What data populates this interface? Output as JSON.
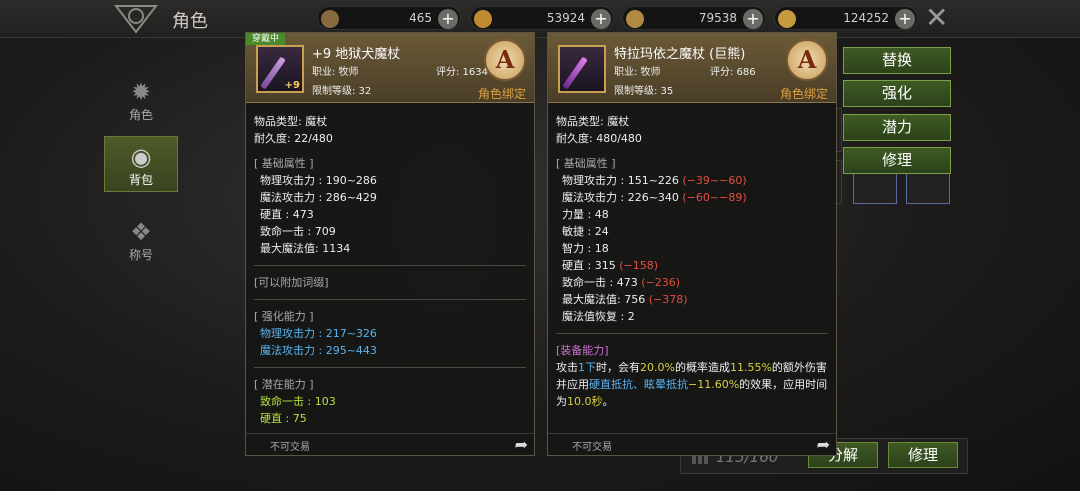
{
  "header": {
    "title": "角色",
    "resources": [
      {
        "icon": "ticket-icon",
        "value": "465",
        "color": "#8a6a40"
      },
      {
        "icon": "coin-ring-icon",
        "value": "53924",
        "color": "#c08a30"
      },
      {
        "icon": "gold-bag-icon",
        "value": "79538",
        "color": "#b08a40"
      },
      {
        "icon": "gem-coin-icon",
        "value": "124252",
        "color": "#c89a40"
      }
    ]
  },
  "nav": {
    "items": [
      {
        "label": "角色",
        "icon": "character-icon"
      },
      {
        "label": "背包",
        "icon": "backpack-icon"
      },
      {
        "label": "称号",
        "icon": "title-icon"
      }
    ],
    "active": "背包"
  },
  "actions": [
    "替换",
    "强化",
    "潜力",
    "修理"
  ],
  "bottom": {
    "capacity": "115/160",
    "decompose": "分解",
    "repair": "修理"
  },
  "equipped": {
    "tag": "穿戴中",
    "name": "+9 地狱犬魔杖",
    "enhance": "+9",
    "job": "职业: 牧师",
    "score": "评分: 1634",
    "level_req": "限制等级: 32",
    "grade": "A",
    "bind": "角色绑定",
    "type": "物品类型:   魔杖",
    "durability": "耐久度: 22/480",
    "base_header": "[ 基础属性 ]",
    "base": [
      "物理攻击力 : 190~286",
      "魔法攻击力 : 286~429",
      "硬直 : 473",
      "致命一击 : 709",
      "最大魔法值:   1134"
    ],
    "enchant_note": "[可以附加词缀]",
    "enhance_header": "[ 强化能力 ]",
    "enhance_stats": [
      "物理攻击力 : 217~326",
      "魔法攻击力 : 295~443"
    ],
    "potential_header": "[ 潜在能力 ]",
    "potential": [
      "致命一击 : 103",
      "硬直 : 75"
    ],
    "trade": "不可交易"
  },
  "compare": {
    "name": "特拉玛依之魔杖 (巨熊)",
    "job": "职业: 牧师",
    "score": "评分: 686",
    "level_req": "限制等级: 35",
    "grade": "A",
    "bind": "角色绑定",
    "type": "物品类型:   魔杖",
    "durability": "耐久度: 480/480",
    "base_header": "[ 基础属性 ]",
    "base": [
      {
        "text": "物理攻击力 : 151~226 ",
        "diff": "(−39~−60)"
      },
      {
        "text": "魔法攻击力 : 226~340 ",
        "diff": "(−60~−89)"
      },
      {
        "text": "力量 : 48",
        "diff": ""
      },
      {
        "text": "敏捷 : 24",
        "diff": ""
      },
      {
        "text": "智力 : 18",
        "diff": ""
      },
      {
        "text": "硬直 : 315 ",
        "diff": "(−158)"
      },
      {
        "text": "致命一击 : 473 ",
        "diff": "(−236)"
      },
      {
        "text": "最大魔法值:   756 ",
        "diff": "(−378)"
      },
      {
        "text": "魔法值恢复 : 2",
        "diff": ""
      }
    ],
    "equip_header": "[装备能力]",
    "effect": {
      "p1": "攻击",
      "h1": "1下",
      "p2": "时，会有",
      "h2": "20.0%",
      "p3": "的概率造成",
      "h3": "11.55%",
      "p4": "的额外伤害并应用",
      "h4": "硬直抵抗、眩晕抵抗",
      "h5": "−11.60%",
      "p5": "的效果，应用时间为",
      "h6": "10.0秒",
      "p6": "。"
    },
    "trade": "不可交易"
  }
}
